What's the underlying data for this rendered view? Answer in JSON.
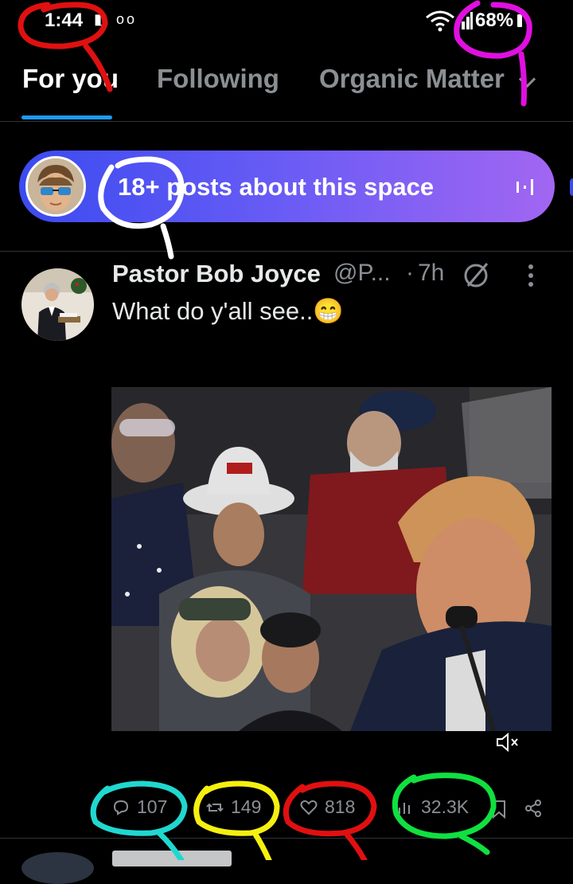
{
  "status_bar": {
    "time": "1:44",
    "left_icons": "◧ ᴏᴏ",
    "signal": "◢",
    "battery_text": "68%"
  },
  "tabs": [
    {
      "label": "For you",
      "active": true
    },
    {
      "label": "Following",
      "active": false
    },
    {
      "label": "Organic Matter",
      "active": false
    }
  ],
  "space_banner": {
    "text": "18+ posts about this space",
    "icon": "equalizer-icon"
  },
  "post": {
    "author": "Pastor Bob Joyce",
    "handle": "@P...",
    "separator": "·",
    "time": "7h",
    "text": "What do y'all see..😁",
    "stats": {
      "replies": "107",
      "reposts": "149",
      "likes": "818",
      "views": "32.3K"
    }
  },
  "colors": {
    "accent": "#1d9bf0",
    "pill_start": "#3b4bf0",
    "pill_end": "#a266f2",
    "annot_red": "#e01010",
    "annot_magenta": "#e010e0",
    "annot_white": "#ffffff",
    "annot_cyan": "#20d8d0",
    "annot_yellow": "#f5f010",
    "annot_green": "#10e040"
  }
}
